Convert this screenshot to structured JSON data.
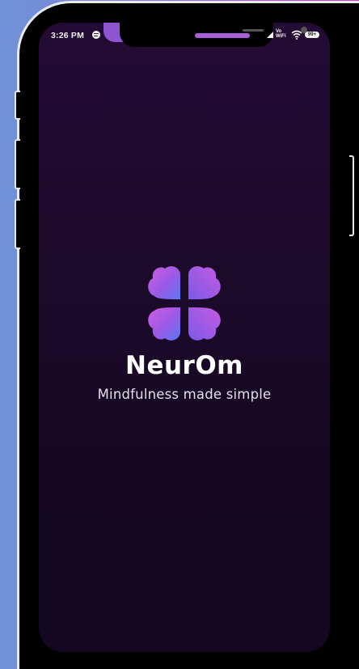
{
  "status_bar": {
    "time": "3:26 PM",
    "vowifi": "Vo\nWiFi",
    "battery": "99+"
  },
  "app": {
    "name": "NeurOm",
    "tagline": "Mindfulness made simple"
  },
  "colors": {
    "background_top": "#240b35",
    "background_bottom": "#140721",
    "logo_gradient_start": "#d05ce0",
    "logo_gradient_end": "#5a78f0",
    "text_primary": "#ffffff"
  },
  "icons": {
    "logo": "neurom-clover-brain-icon",
    "status_media": "spotify-icon",
    "signal": "signal-icon",
    "wifi": "wifi-icon",
    "battery": "battery-icon"
  }
}
